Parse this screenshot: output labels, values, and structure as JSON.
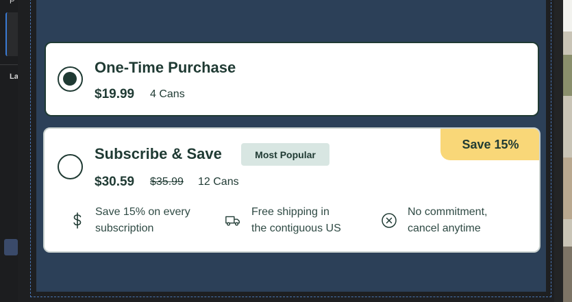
{
  "left_panel": {
    "top_label": "P",
    "section_label": "La"
  },
  "options": [
    {
      "title": "One-Time Purchase",
      "price": "$19.99",
      "quantity": "4 Cans",
      "selected": true
    },
    {
      "title": "Subscribe & Save",
      "badge": "Most Popular",
      "price": "$30.59",
      "original_price": "$35.99",
      "quantity": "12 Cans",
      "selected": false,
      "ribbon": "Save 15%",
      "features": [
        {
          "icon": "dollar-icon",
          "line1": "Save 15% on every",
          "line2": "subscription"
        },
        {
          "icon": "truck-icon",
          "line1": "Free shipping in",
          "line2": "the contiguous US"
        },
        {
          "icon": "x-circle-icon",
          "line1": "No commitment,",
          "line2": "cancel anytime"
        }
      ]
    }
  ],
  "colors": {
    "panel_bg": "#2c4058",
    "text": "#1f3a33",
    "badge_bg": "#d8e6e2",
    "ribbon_bg": "#f9d778"
  }
}
